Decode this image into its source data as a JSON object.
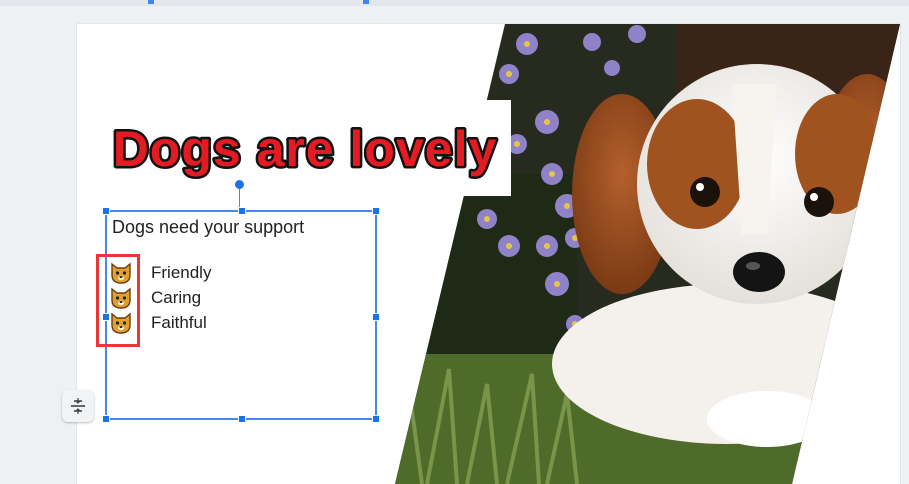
{
  "slide": {
    "title": "Dogs are lovely",
    "textbox": {
      "heading": "Dogs need your support",
      "bullets": [
        {
          "label": "Friendly",
          "icon": "dog-face-icon"
        },
        {
          "label": "Caring",
          "icon": "dog-face-icon"
        },
        {
          "label": "Faithful",
          "icon": "dog-face-icon"
        }
      ]
    },
    "photo": {
      "subject": "puppy-with-purple-flowers-photo"
    }
  },
  "colors": {
    "title_fill": "#e31b23",
    "title_outline": "#111111",
    "selection": "#4a86e8",
    "highlight": "#e53935"
  },
  "toolbar": {
    "side_button_icon": "align-icon"
  }
}
